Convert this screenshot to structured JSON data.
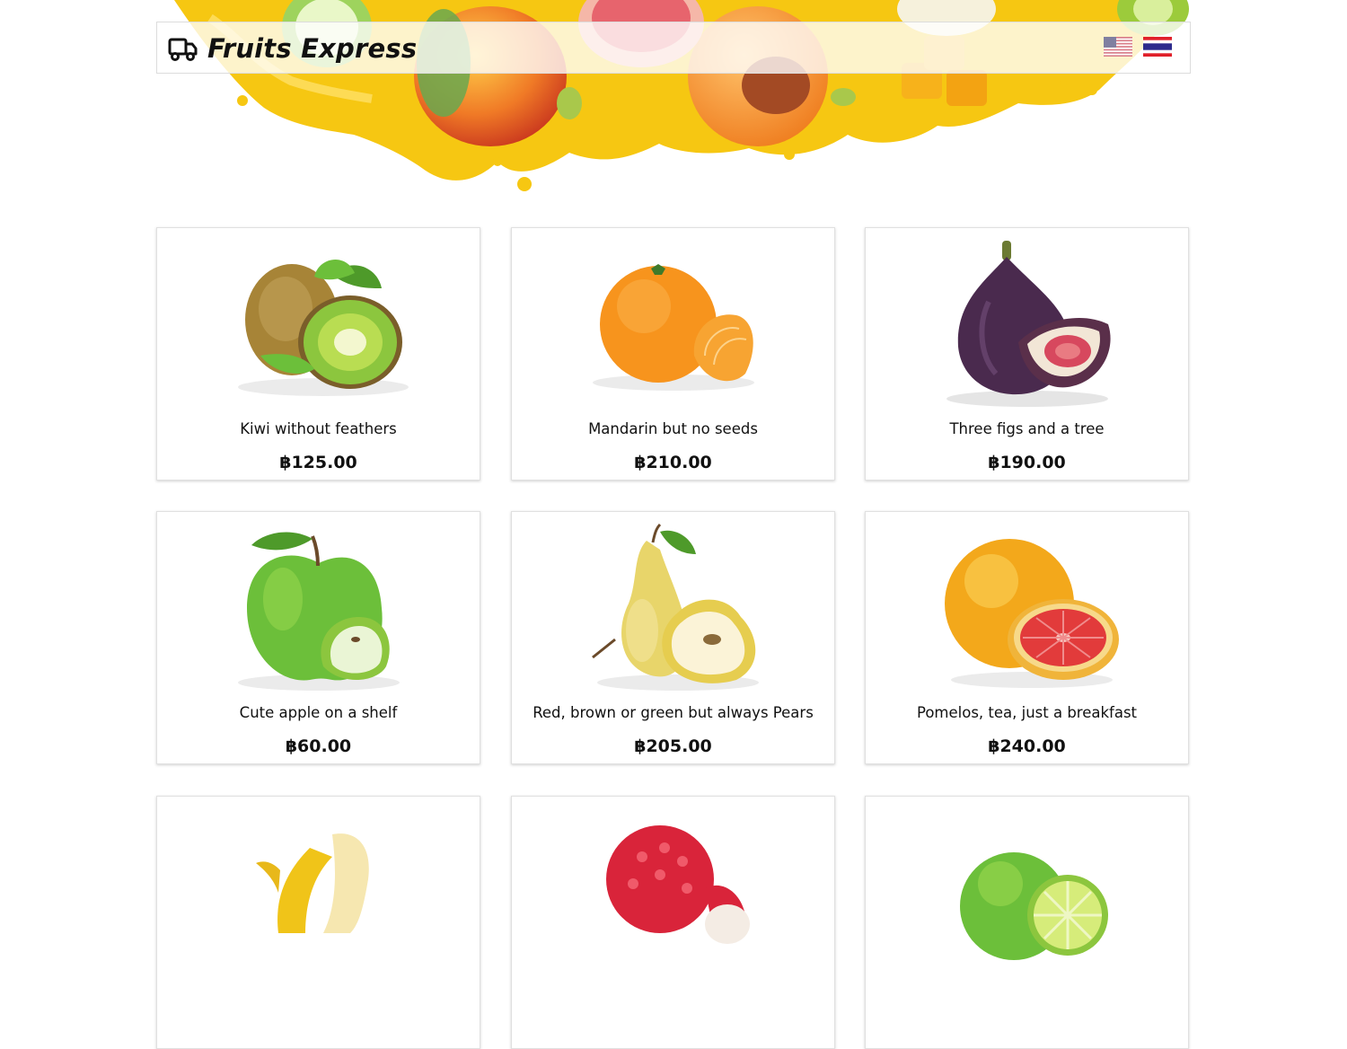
{
  "header": {
    "brand": "Fruits Express",
    "languages": [
      {
        "code": "en",
        "flag": "us-flag-icon"
      },
      {
        "code": "th",
        "flag": "th-flag-icon"
      }
    ]
  },
  "products": [
    {
      "name": "Kiwi without feathers",
      "price": "฿125.00",
      "icon": "kiwi-icon"
    },
    {
      "name": "Mandarin but no seeds",
      "price": "฿210.00",
      "icon": "mandarin-icon"
    },
    {
      "name": "Three figs and a tree",
      "price": "฿190.00",
      "icon": "fig-icon"
    },
    {
      "name": "Cute apple on a shelf",
      "price": "฿60.00",
      "icon": "apple-icon"
    },
    {
      "name": "Red, brown or green but always Pears",
      "price": "฿205.00",
      "icon": "pear-icon"
    },
    {
      "name": "Pomelos, tea, just a breakfast",
      "price": "฿240.00",
      "icon": "pomelo-icon"
    },
    {
      "name": "",
      "price": "",
      "icon": "banana-icon"
    },
    {
      "name": "",
      "price": "",
      "icon": "lychee-icon"
    },
    {
      "name": "",
      "price": "",
      "icon": "lime-icon"
    }
  ],
  "colors": {
    "juice": "#f6c712",
    "kiwi_green": "#8cc63e",
    "mandarin": "#f7941d",
    "fig": "#4a2a4e",
    "apple": "#6cbf3a",
    "pear": "#e8d56a",
    "pomelo": "#f3a81b",
    "grapefruit_flesh": "#e23b3b"
  }
}
